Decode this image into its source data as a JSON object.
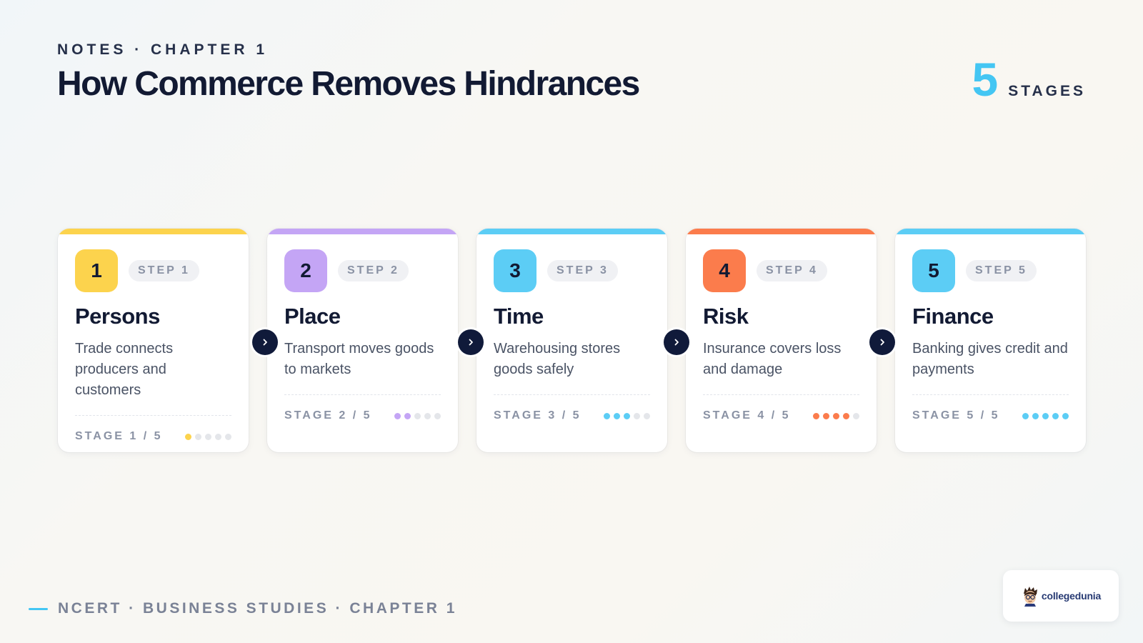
{
  "header": {
    "eyebrow": "NOTES · CHAPTER 1",
    "title": "How Commerce Removes Hindrances",
    "counter_value": "5",
    "counter_label": "STAGES"
  },
  "steps": [
    {
      "number": "1",
      "pill": "STEP 1",
      "title": "Persons",
      "description": "Trade connects producers and customers",
      "stage": "STAGE 1 / 5",
      "color": "#fcd34d",
      "filled_dots": 1
    },
    {
      "number": "2",
      "pill": "STEP 2",
      "title": "Place",
      "description": "Transport moves goods to markets",
      "stage": "STAGE 2 / 5",
      "color": "#c4a5f5",
      "filled_dots": 2
    },
    {
      "number": "3",
      "pill": "STEP 3",
      "title": "Time",
      "description": "Warehousing stores goods safely",
      "stage": "STAGE 3 / 5",
      "color": "#5ccdf5",
      "filled_dots": 3
    },
    {
      "number": "4",
      "pill": "STEP 4",
      "title": "Risk",
      "description": "Insurance covers loss and damage",
      "stage": "STAGE 4 / 5",
      "color": "#fb7c4c",
      "filled_dots": 4
    },
    {
      "number": "5",
      "pill": "STEP 5",
      "title": "Finance",
      "description": "Banking gives credit and payments",
      "stage": "STAGE 5 / 5",
      "color": "#5ccdf5",
      "filled_dots": 5
    }
  ],
  "total_dots": 5,
  "arrow_icon": "chevron-right-icon",
  "footer": {
    "text": "NCERT · BUSINESS STUDIES · CHAPTER 1",
    "accent": "#44c6f3"
  },
  "brand": {
    "name": "collegedunia"
  }
}
